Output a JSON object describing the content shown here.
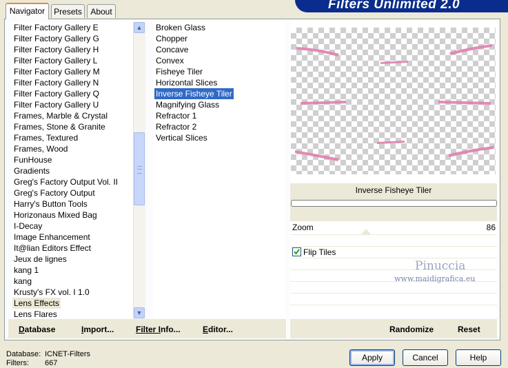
{
  "tabs": {
    "navigator": "Navigator",
    "presets": "Presets",
    "about": "About"
  },
  "banner_title": "Filters Unlimited 2.0",
  "categories": [
    "Filter Factory Gallery E",
    "Filter Factory Gallery G",
    "Filter Factory Gallery H",
    "Filter Factory Gallery L",
    "Filter Factory Gallery M",
    "Filter Factory Gallery N",
    "Filter Factory Gallery Q",
    "Filter Factory Gallery U",
    "Frames, Marble & Crystal",
    "Frames, Stone & Granite",
    "Frames, Textured",
    "Frames, Wood",
    "FunHouse",
    "Gradients",
    "Greg's Factory Output Vol. II",
    "Greg's Factory Output",
    "Harry's Button Tools",
    "Horizonaus Mixed Bag",
    "I-Decay",
    "Image Enhancement",
    "It@lian Editors Effect",
    "Jeux de lignes",
    "kang 1",
    "kang",
    "Krusty's FX vol. I 1.0",
    "Lens Effects",
    "Lens Flares"
  ],
  "selected_category": "Lens Effects",
  "filters": [
    "Broken Glass",
    "Chopper",
    "Concave",
    "Convex",
    "Fisheye Tiler",
    "Horizontal Slices",
    "Inverse Fisheye Tiler",
    "Magnifying Glass",
    "Refractor 1",
    "Refractor 2",
    "Vertical Slices"
  ],
  "selected_filter": "Inverse Fisheye Tiler",
  "preview_filter_name": "Inverse Fisheye Tiler",
  "params": {
    "zoom_label": "Zoom",
    "zoom_value": "86",
    "flip_tiles_label": "Flip Tiles",
    "flip_tiles_checked": true
  },
  "watermark": {
    "name": "Pinuccia",
    "site": "www.maidigrafica.eu"
  },
  "left_buttons": {
    "database": "Database",
    "import": "Import...",
    "filter_info": "Filter Info...",
    "editor": "Editor..."
  },
  "right_buttons": {
    "randomize": "Randomize",
    "reset": "Reset"
  },
  "status": {
    "database_label": "Database:",
    "database_value": "ICNET-Filters",
    "filters_label": "Filters:",
    "filters_value": "667"
  },
  "dialog_buttons": {
    "apply": "Apply",
    "cancel": "Cancel",
    "help": "Help"
  },
  "colors": {
    "selection": "#316ac5",
    "window": "#ece9d8",
    "banner": "#0a2c8c"
  }
}
